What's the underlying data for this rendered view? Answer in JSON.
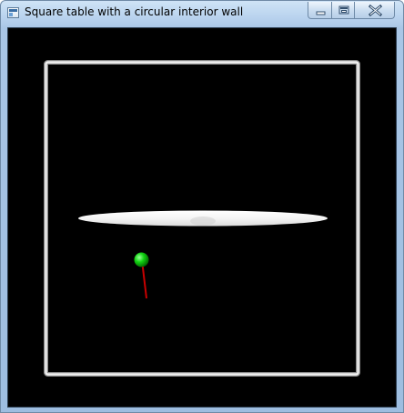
{
  "window": {
    "title": "Square table with a circular interior wall",
    "controls": {
      "minimize_icon": "minimize-icon",
      "maximize_icon": "restore-icon",
      "close_icon": "close-icon"
    }
  },
  "scene": {
    "background_color": "#000000",
    "table_border_color": "#e6e6e6",
    "interior_wall_color": "#f2f2f2",
    "ball_color": "#00cc00",
    "direction_vector_color": "#cc0000"
  }
}
